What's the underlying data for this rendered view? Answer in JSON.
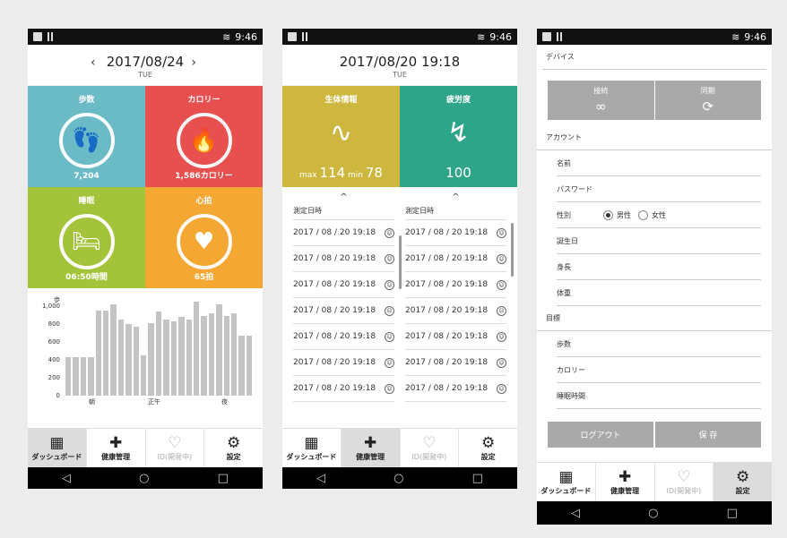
{
  "status": {
    "time": "9:46",
    "signal": "1",
    "sim": "2"
  },
  "tabs": [
    {
      "label": "ダッシュボード",
      "icon": "dashboard-icon",
      "glyph": "▦"
    },
    {
      "label": "健康管理",
      "icon": "plus-icon",
      "glyph": "✚"
    },
    {
      "label": "ID(開発中)",
      "icon": "heart-icon",
      "glyph": "♡"
    },
    {
      "label": "設定",
      "icon": "gear-icon",
      "glyph": "⚙"
    }
  ],
  "nav": {
    "back": "◁",
    "home": "○",
    "recent": "□"
  },
  "dashboard": {
    "date": "2017/08/24",
    "weekday": "TUE",
    "prev": "‹",
    "next": "›",
    "tiles": [
      {
        "title": "歩数",
        "value": "7,204",
        "color": "#6bbbc7",
        "glyph": "👣"
      },
      {
        "title": "カロリー",
        "value": "1,586カロリー",
        "color": "#e84f4f",
        "glyph": "🔥"
      },
      {
        "title": "睡眠",
        "value": "06:50時間",
        "color": "#a3c43a",
        "glyph": "🛏"
      },
      {
        "title": "心拍",
        "value": "65拍",
        "color": "#f5a733",
        "glyph": "♥"
      }
    ],
    "chart_data": {
      "type": "bar",
      "ylabel": "歩",
      "yticks": [
        "1,000",
        "800",
        "600",
        "400",
        "200",
        "0"
      ],
      "ylim": [
        0,
        1000
      ],
      "xlabels": [
        "朝",
        "正午",
        "夜"
      ],
      "values": [
        410,
        410,
        410,
        410,
        910,
        910,
        980,
        820,
        770,
        740,
        430,
        780,
        900,
        820,
        800,
        850,
        820,
        1010,
        860,
        880,
        980,
        860,
        880,
        640,
        640
      ]
    }
  },
  "history": {
    "datetime": "2017/08/20 19:18",
    "weekday": "TUE",
    "tile1": {
      "title": "生体情報",
      "max_label": "max",
      "max": "114",
      "min_label": "min",
      "min": "78",
      "color": "#cdb73e"
    },
    "tile2": {
      "title": "疲労度",
      "value": "100",
      "color": "#2ea488"
    },
    "caret": "^",
    "col_header": "測定日時",
    "rows": [
      "2017 / 08 / 20  19:18",
      "2017 / 08 / 20  19:18",
      "2017 / 08 / 20  19:18",
      "2017 / 08 / 20  19:18",
      "2017 / 08 / 20  19:18",
      "2017 / 08 / 20  19:18",
      "2017 / 08 / 20  19:18"
    ]
  },
  "settings": {
    "device": "デバイス",
    "connect": "接続",
    "sync": "同期",
    "account": "アカウント",
    "fields": [
      "名前",
      "パスワード"
    ],
    "gender": "性別",
    "male": "男性",
    "female": "女性",
    "fields2": [
      "誕生日",
      "身長",
      "体重"
    ],
    "goal": "目標",
    "goals": [
      "歩数",
      "カロリー",
      "睡眠時間"
    ],
    "logout": "ログアウト",
    "save": "保 存"
  }
}
